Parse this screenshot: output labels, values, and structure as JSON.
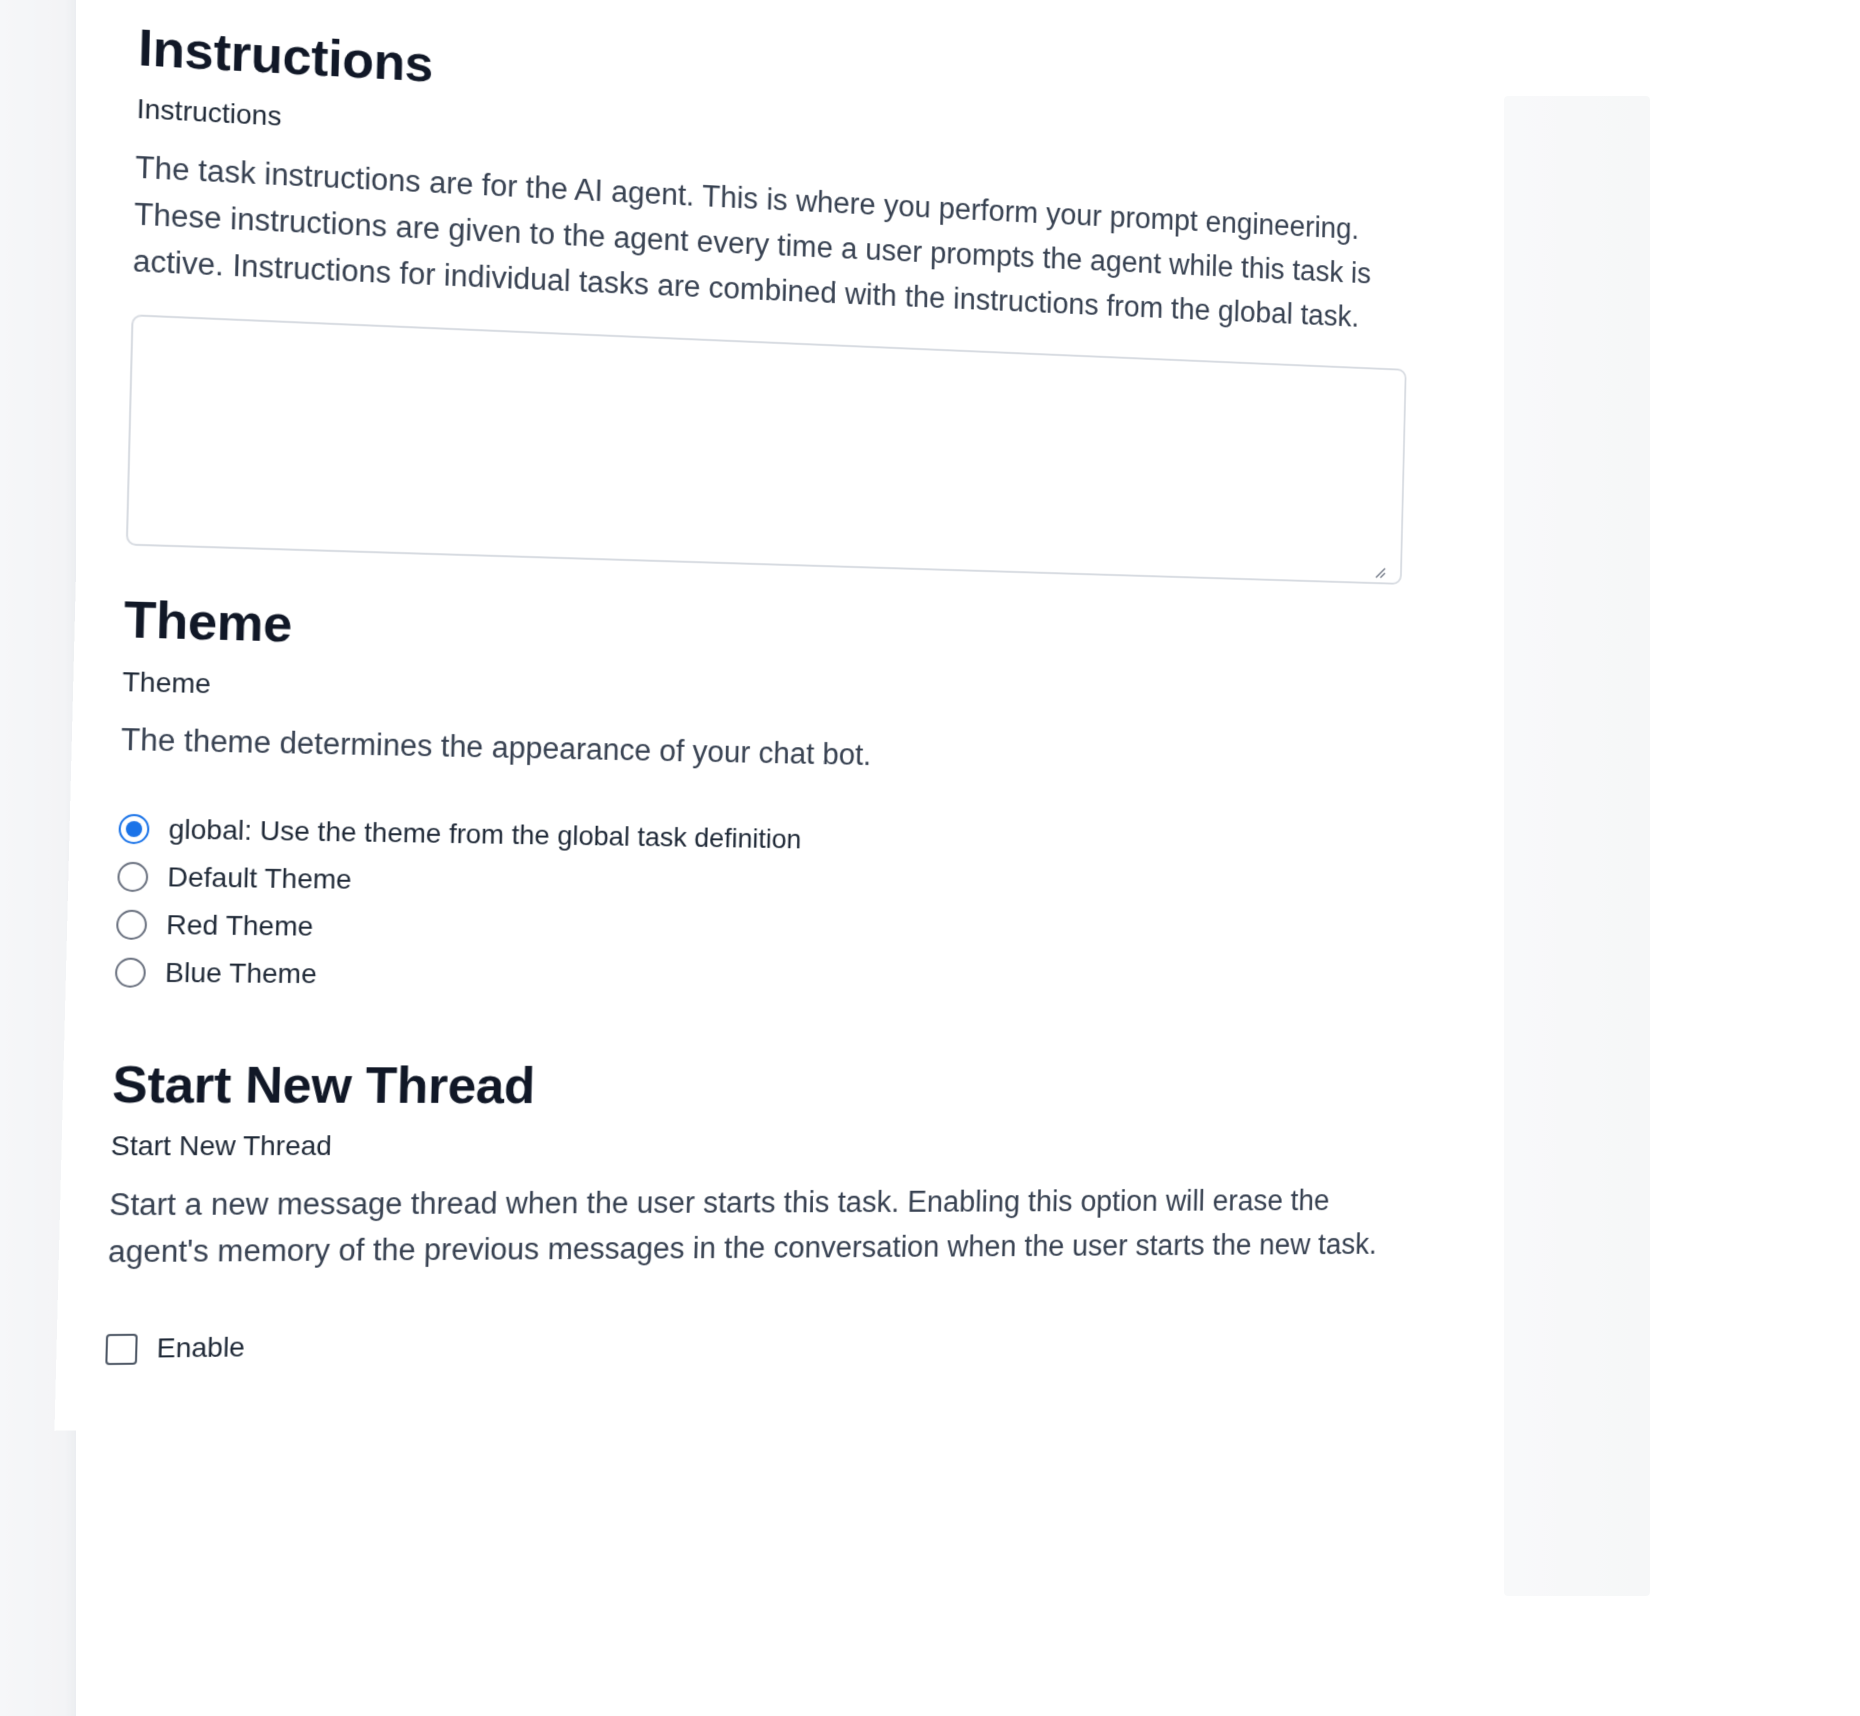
{
  "instructions": {
    "title": "Instructions",
    "label": "Instructions",
    "description": "The task instructions are for the AI agent. This is where you perform your prompt engineering. These instructions are given to the agent every time a user prompts the agent while this task is active. Instructions for individual tasks are combined with the instructions from the global task.",
    "value": "",
    "placeholder": ""
  },
  "theme": {
    "title": "Theme",
    "label": "Theme",
    "description": "The theme determines the appearance of your chat bot.",
    "options": [
      {
        "label": "global: Use the theme from the global task definition",
        "selected": true
      },
      {
        "label": "Default Theme",
        "selected": false
      },
      {
        "label": "Red Theme",
        "selected": false
      },
      {
        "label": "Blue Theme",
        "selected": false
      }
    ]
  },
  "thread": {
    "title": "Start New Thread",
    "label": "Start New Thread",
    "description": "Start a new message thread when the user starts this task. Enabling this option will erase the agent's memory of the previous messages in the conversation when the user starts the new task.",
    "checkbox_label": "Enable",
    "checked": false
  },
  "colors": {
    "accent": "#1a73e8",
    "heading": "#111827",
    "text": "#374151",
    "border": "#d7dbe1"
  }
}
